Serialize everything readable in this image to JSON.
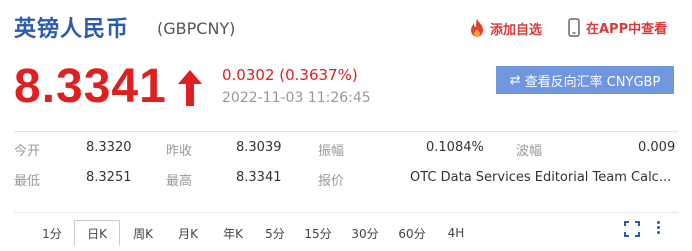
{
  "header": {
    "title": "英镑人民币",
    "code": "(GBPCNY)",
    "add_favorite": "添加自选",
    "view_in_app": "在APP中查看"
  },
  "quote": {
    "price": "8.3341",
    "change": "0.0302 (0.3637%)",
    "timestamp": "2022-11-03 11:26:45",
    "reverse_button": "查看反向汇率 CNYGBP",
    "direction": "up",
    "up_color": "#e02020"
  },
  "stats": {
    "row1": [
      {
        "label": "今开",
        "value": "8.3320"
      },
      {
        "label": "昨收",
        "value": "8.3039"
      },
      {
        "label": "振幅",
        "value": "0.1084%"
      },
      {
        "label": "波幅",
        "value": "0.009"
      }
    ],
    "row2": [
      {
        "label": "最低",
        "value": "8.3251"
      },
      {
        "label": "最高",
        "value": "8.3341"
      },
      {
        "label": "报价",
        "value": "OTC Data Services Editorial Team Calc..."
      }
    ]
  },
  "tabs": [
    "1分",
    "日K",
    "周K",
    "月K",
    "年K",
    "5分",
    "15分",
    "30分",
    "60分",
    "4H"
  ],
  "active_tab": "日K",
  "colors": {
    "brand": "#2a5bb0",
    "accent": "#d93a3a",
    "button": "#6f96de"
  }
}
